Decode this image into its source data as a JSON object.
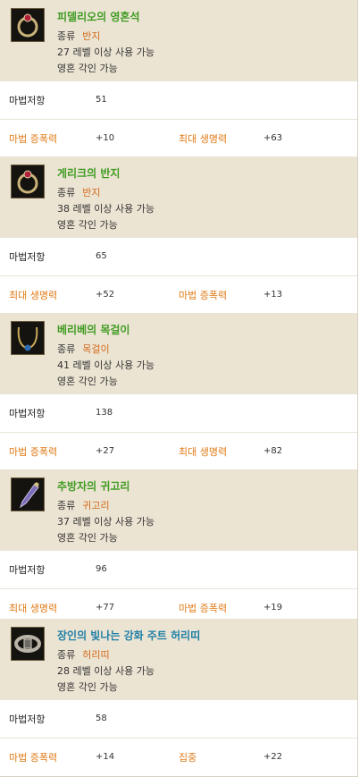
{
  "labels": {
    "type": "종류",
    "level_suffix": "레벨 이상 사용 가능",
    "soul": "영혼 각인 가능",
    "magic_resist": "마법저항"
  },
  "items": [
    {
      "name": "피델리오의 영혼석",
      "name_color": "green",
      "icon": "ring-icon",
      "type_value": "반지",
      "level": "27",
      "resist": "51",
      "stat1_label": "마법 증폭력",
      "stat1_value": "+10",
      "stat2_label": "최대 생명력",
      "stat2_value": "+63"
    },
    {
      "name": "게리크의 반지",
      "name_color": "green",
      "icon": "ring-icon",
      "type_value": "반지",
      "level": "38",
      "resist": "65",
      "stat1_label": "최대 생명력",
      "stat1_value": "+52",
      "stat2_label": "마법 증폭력",
      "stat2_value": "+13"
    },
    {
      "name": "베리베의 목걸이",
      "name_color": "green",
      "icon": "necklace-icon",
      "type_value": "목걸이",
      "level": "41",
      "resist": "138",
      "stat1_label": "마법 증폭력",
      "stat1_value": "+27",
      "stat2_label": "최대 생명력",
      "stat2_value": "+82"
    },
    {
      "name": "추방자의 귀고리",
      "name_color": "green",
      "icon": "earring-icon",
      "type_value": "귀고리",
      "level": "37",
      "resist": "96",
      "stat1_label": "최대 생명력",
      "stat1_value": "+77",
      "stat2_label": "마법 증폭력",
      "stat2_value": "+19"
    },
    {
      "name": "장인의 빛나는 강화 주트 허리띠",
      "name_color": "blue",
      "icon": "belt-icon",
      "type_value": "허리띠",
      "level": "28",
      "resist": "58",
      "stat1_label": "마법 증폭력",
      "stat1_value": "+14",
      "stat2_label": "집중",
      "stat2_value": "+22"
    }
  ]
}
